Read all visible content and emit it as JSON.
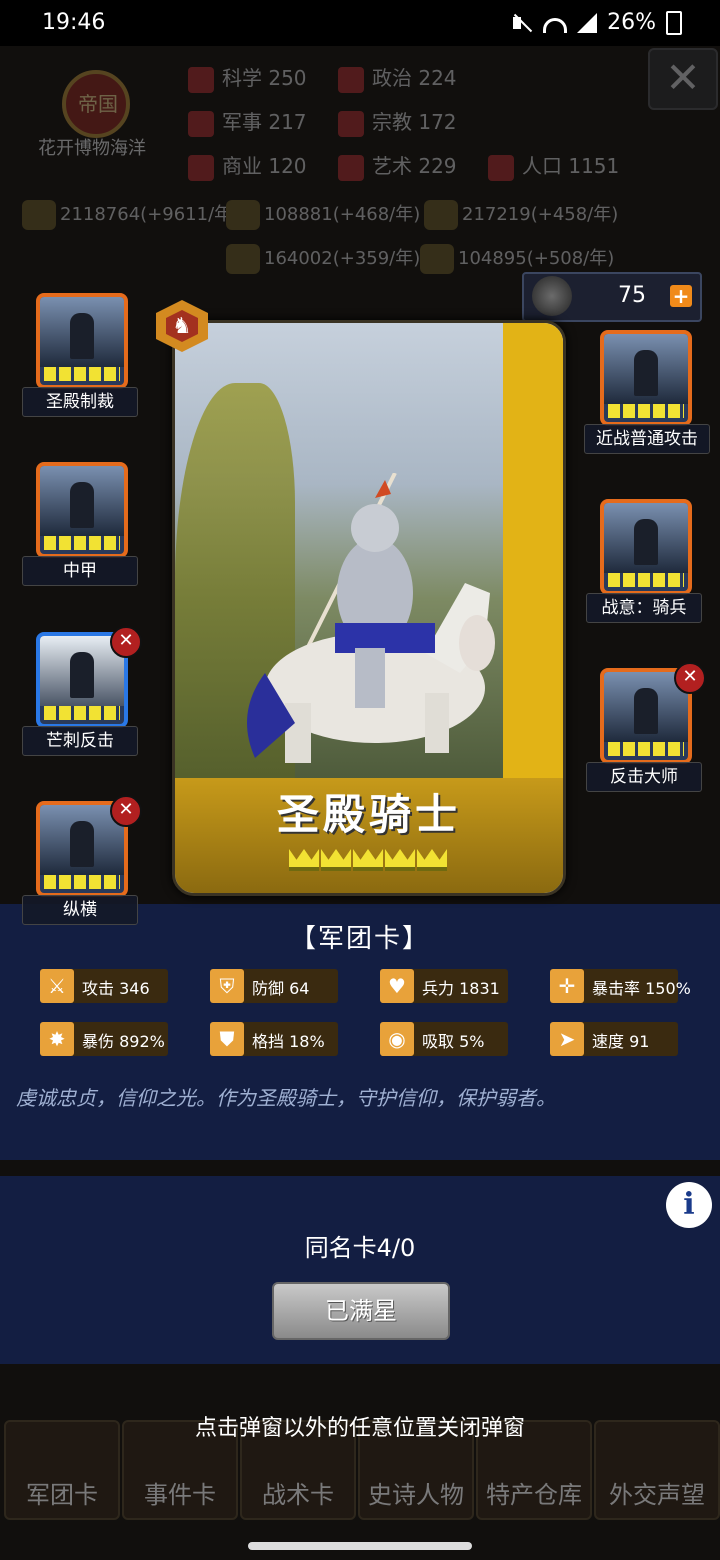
{
  "status_bar": {
    "time": "19:46",
    "battery": "26%"
  },
  "background": {
    "empire_badge": "帝国",
    "empire_name": "花开博物海洋",
    "stats": [
      {
        "label": "科学",
        "value": "250"
      },
      {
        "label": "政治",
        "value": "224"
      },
      {
        "label": "军事",
        "value": "217"
      },
      {
        "label": "宗教",
        "value": "172"
      },
      {
        "label": "商业",
        "value": "120"
      },
      {
        "label": "艺术",
        "value": "229"
      },
      {
        "label": "人口",
        "value": "1151"
      }
    ],
    "resources": [
      "2118764(+9611/年",
      "108881(+468/年)",
      "217219(+458/年)",
      "164002(+359/年)",
      "104895(+508/年)"
    ],
    "nav": [
      "军团卡",
      "事件卡",
      "战术卡",
      "史诗人物",
      "特产仓库",
      "外交声望"
    ]
  },
  "crown_counter": {
    "value": "75",
    "plus": "+"
  },
  "card": {
    "name": "圣殿骑士",
    "stars": 5
  },
  "skills_left": [
    {
      "label": "圣殿制裁",
      "removable": false
    },
    {
      "label": "中甲",
      "removable": false
    },
    {
      "label": "芒刺反击",
      "removable": true
    },
    {
      "label": "纵横",
      "removable": true
    }
  ],
  "skills_right": [
    {
      "label": "近战普通攻击",
      "removable": false
    },
    {
      "label": "战意：骑兵",
      "removable": false
    },
    {
      "label": "反击大师",
      "removable": true
    }
  ],
  "panel": {
    "title": "【军团卡】",
    "stats": [
      {
        "label": "攻击 346"
      },
      {
        "label": "防御 64"
      },
      {
        "label": "兵力 1831"
      },
      {
        "label": "暴击率 150%"
      },
      {
        "label": "暴伤 892%"
      },
      {
        "label": "格挡 18%"
      },
      {
        "label": "吸取 5%"
      },
      {
        "label": "速度 91"
      }
    ],
    "description": "虔诚忠贞，信仰之光。作为圣殿骑士，守护信仰，保护弱者。"
  },
  "duplicate": {
    "label": "同名卡4/0",
    "button": "已满星",
    "info": "i"
  },
  "close_hint": "点击弹窗以外的任意位置关闭弹窗",
  "colors": {
    "accent_orange": "#e56b1c",
    "accent_blue": "#2a78e6",
    "panel_bg": "#142046"
  }
}
